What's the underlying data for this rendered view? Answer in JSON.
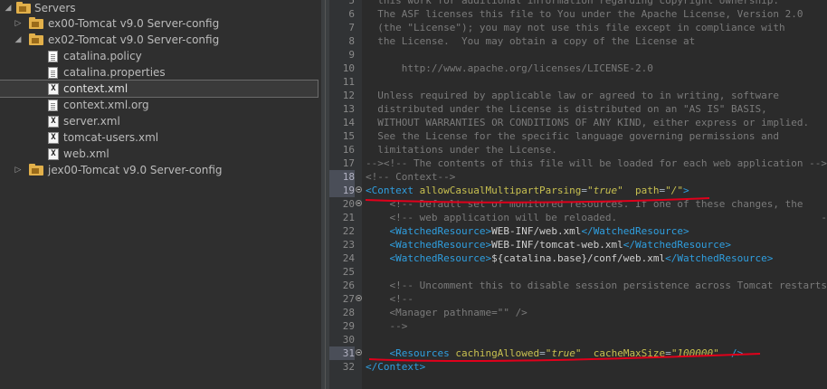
{
  "tree": {
    "root": "Servers",
    "items": [
      {
        "label": "ex00-Tomcat v9.0 Server-config",
        "expanded": false,
        "icon": "server-folder-icon"
      },
      {
        "label": "ex02-Tomcat v9.0 Server-config",
        "expanded": true,
        "icon": "server-folder-icon"
      },
      {
        "label": "catalina.policy",
        "icon": "file-icon"
      },
      {
        "label": "catalina.properties",
        "icon": "file-icon"
      },
      {
        "label": "context.xml",
        "icon": "xml-file-icon",
        "selected": true
      },
      {
        "label": "context.xml.org",
        "icon": "file-icon"
      },
      {
        "label": "server.xml",
        "icon": "xml-file-icon"
      },
      {
        "label": "tomcat-users.xml",
        "icon": "xml-file-icon"
      },
      {
        "label": "web.xml",
        "icon": "xml-file-icon"
      },
      {
        "label": "jex00-Tomcat v9.0 Server-config",
        "expanded": false,
        "icon": "server-folder-icon"
      }
    ]
  },
  "editor": {
    "lines": [
      {
        "n": "5",
        "t": "  this work for additional information regarding copyright ownership."
      },
      {
        "n": "6",
        "t": "  The ASF licenses this file to You under the Apache License, Version 2.0"
      },
      {
        "n": "7",
        "t": "  (the \"License\"); you may not use this file except in compliance with"
      },
      {
        "n": "8",
        "t": "  the License.  You may obtain a copy of the License at"
      },
      {
        "n": "9",
        "t": ""
      },
      {
        "n": "10",
        "t": "      http://www.apache.org/licenses/LICENSE-2.0"
      },
      {
        "n": "11",
        "t": ""
      },
      {
        "n": "12",
        "t": "  Unless required by applicable law or agreed to in writing, software"
      },
      {
        "n": "13",
        "t": "  distributed under the License is distributed on an \"AS IS\" BASIS,"
      },
      {
        "n": "14",
        "t": "  WITHOUT WARRANTIES OR CONDITIONS OF ANY KIND, either express or implied."
      },
      {
        "n": "15",
        "t": "  See the License for the specific language governing permissions and"
      },
      {
        "n": "16",
        "t": "  limitations under the License."
      },
      {
        "n": "17",
        "t": "--><!-- The contents of this file will be loaded for each web application -->"
      },
      {
        "n": "18",
        "t": "<!-- Context-->"
      },
      {
        "n": "19",
        "t": ""
      },
      {
        "n": "20",
        "t": "    <!-- Default set of monitored resources. If one of these changes, the    -->"
      },
      {
        "n": "21",
        "t": "    <!-- web application will be reloaded.                                  -->"
      },
      {
        "n": "22",
        "t": ""
      },
      {
        "n": "23",
        "t": ""
      },
      {
        "n": "24",
        "t": ""
      },
      {
        "n": "25",
        "t": ""
      },
      {
        "n": "26",
        "t": "    <!-- Uncomment this to disable session persistence across Tomcat restarts -->"
      },
      {
        "n": "27",
        "t": "    <!--"
      },
      {
        "n": "28",
        "t": "    <Manager pathname=\"\" />"
      },
      {
        "n": "29",
        "t": "    -->"
      },
      {
        "n": "30",
        "t": ""
      },
      {
        "n": "31",
        "t": ""
      },
      {
        "n": "32",
        "t": ""
      }
    ],
    "context_tag": {
      "name": "Context",
      "attr1": "allowCasualMultipartParsing",
      "val1": "\"true\"",
      "attr2": "path",
      "val2": "\"/\"",
      "close": ">"
    },
    "watched": {
      "tag": "WatchedResource",
      "values": [
        "WEB-INF/web.xml",
        "WEB-INF/tomcat-web.xml",
        "${catalina.base}/conf/web.xml"
      ]
    },
    "resources_tag": {
      "name": "Resources",
      "attr1": "cachingAllowed",
      "val1": "\"true\"",
      "attr2": "cacheMaxSize",
      "val2": "\"100000\"",
      "close": "/>"
    },
    "close_context": "Context",
    "highlight_lines": [
      "18",
      "19",
      "31"
    ],
    "annotation_color": "#e0001b"
  }
}
